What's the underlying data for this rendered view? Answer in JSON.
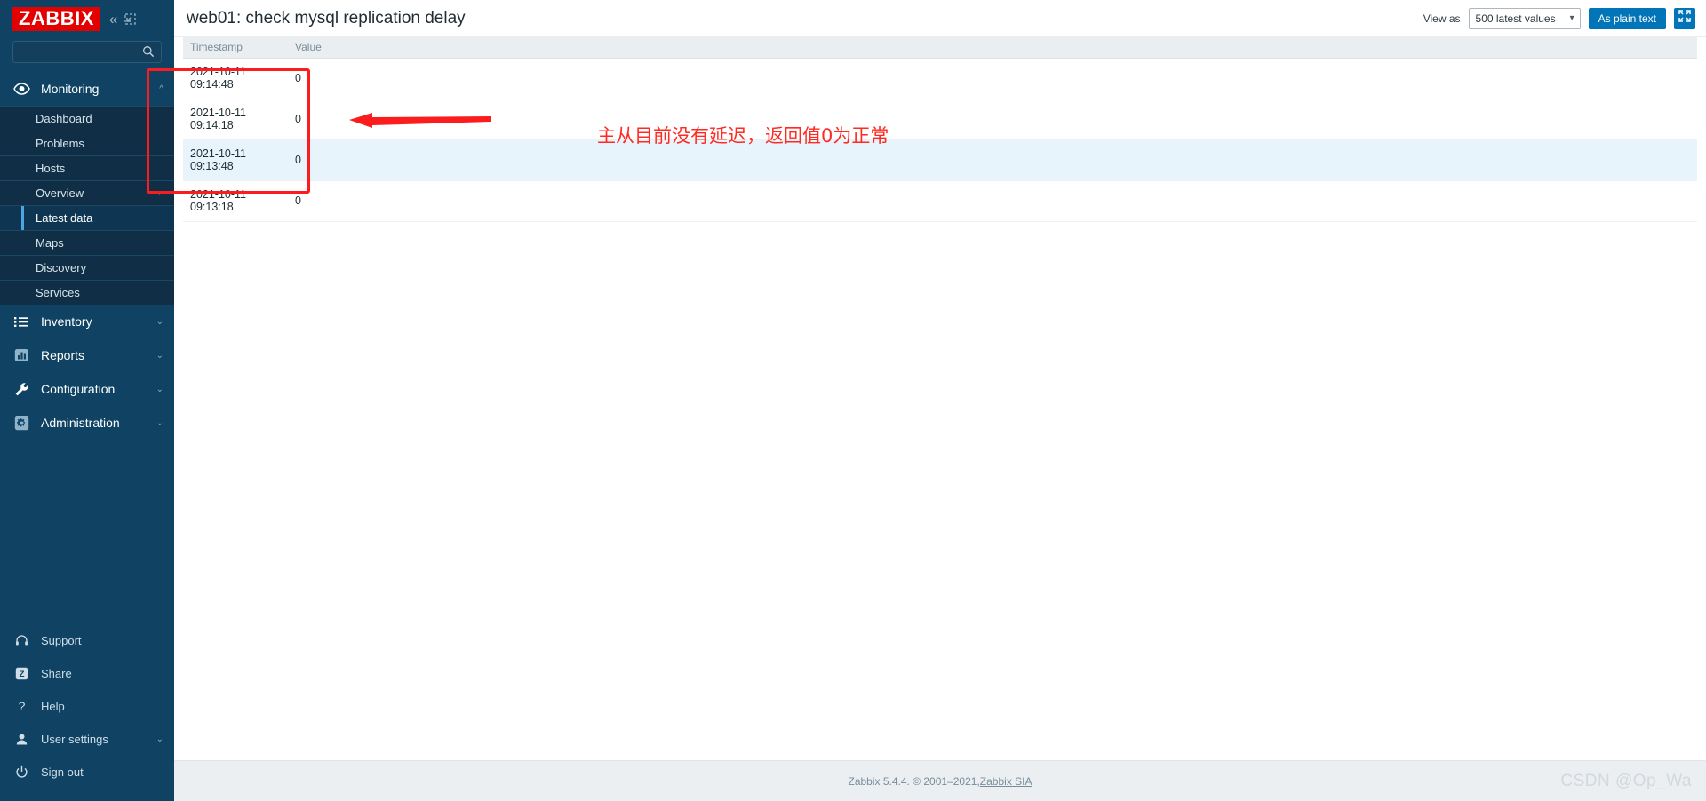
{
  "sidebar": {
    "logo_text": "ZABBIX",
    "collapse_icon": "chevron-double-left-icon",
    "kiosk_icon": "compact-view-icon",
    "search_placeholder": "",
    "search_value": "",
    "groups": [
      {
        "label": "Monitoring",
        "icon": "eye-icon",
        "chevron": "^",
        "expanded": true,
        "items": [
          {
            "label": "Dashboard",
            "active": false,
            "chevron": ""
          },
          {
            "label": "Problems",
            "active": false,
            "chevron": ""
          },
          {
            "label": "Hosts",
            "active": false,
            "chevron": ""
          },
          {
            "label": "Overview",
            "active": false,
            "chevron": "›"
          },
          {
            "label": "Latest data",
            "active": true,
            "chevron": ""
          },
          {
            "label": "Maps",
            "active": false,
            "chevron": ""
          },
          {
            "label": "Discovery",
            "active": false,
            "chevron": ""
          },
          {
            "label": "Services",
            "active": false,
            "chevron": ""
          }
        ]
      },
      {
        "label": "Inventory",
        "icon": "list-icon",
        "chevron": "⌄",
        "expanded": false,
        "items": []
      },
      {
        "label": "Reports",
        "icon": "bar-chart-icon",
        "chevron": "⌄",
        "expanded": false,
        "items": []
      },
      {
        "label": "Configuration",
        "icon": "wrench-icon",
        "chevron": "⌄",
        "expanded": false,
        "items": []
      },
      {
        "label": "Administration",
        "icon": "gear-icon",
        "chevron": "⌄",
        "expanded": false,
        "items": []
      }
    ],
    "bottom_items": [
      {
        "label": "Support",
        "icon": "headset-icon",
        "chevron": ""
      },
      {
        "label": "Share",
        "icon": "zabbix-share-icon",
        "chevron": ""
      },
      {
        "label": "Help",
        "icon": "question-mark-icon",
        "chevron": ""
      },
      {
        "label": "User settings",
        "icon": "user-icon",
        "chevron": "⌄"
      },
      {
        "label": "Sign out",
        "icon": "power-icon",
        "chevron": ""
      }
    ]
  },
  "header": {
    "title": "web01: check mysql replication delay",
    "view_as_label": "View as",
    "view_as_value": "500 latest values",
    "plain_text_button": "As plain text",
    "kiosk_icon": "expand-arrows-icon"
  },
  "table": {
    "columns": [
      "Timestamp",
      "Value"
    ],
    "rows": [
      {
        "timestamp": "2021-10-11 09:14:48",
        "value": "0"
      },
      {
        "timestamp": "2021-10-11 09:14:18",
        "value": "0"
      },
      {
        "timestamp": "2021-10-11 09:13:48",
        "value": "0"
      },
      {
        "timestamp": "2021-10-11 09:13:18",
        "value": "0"
      }
    ]
  },
  "annotation": {
    "text": "主从目前没有延迟，返回值0为正常",
    "color": "#ff2a22"
  },
  "footer": {
    "text": "Zabbix 5.4.4. © 2001–2021, ",
    "link": "Zabbix SIA",
    "watermark": "CSDN @Op_Wa"
  }
}
